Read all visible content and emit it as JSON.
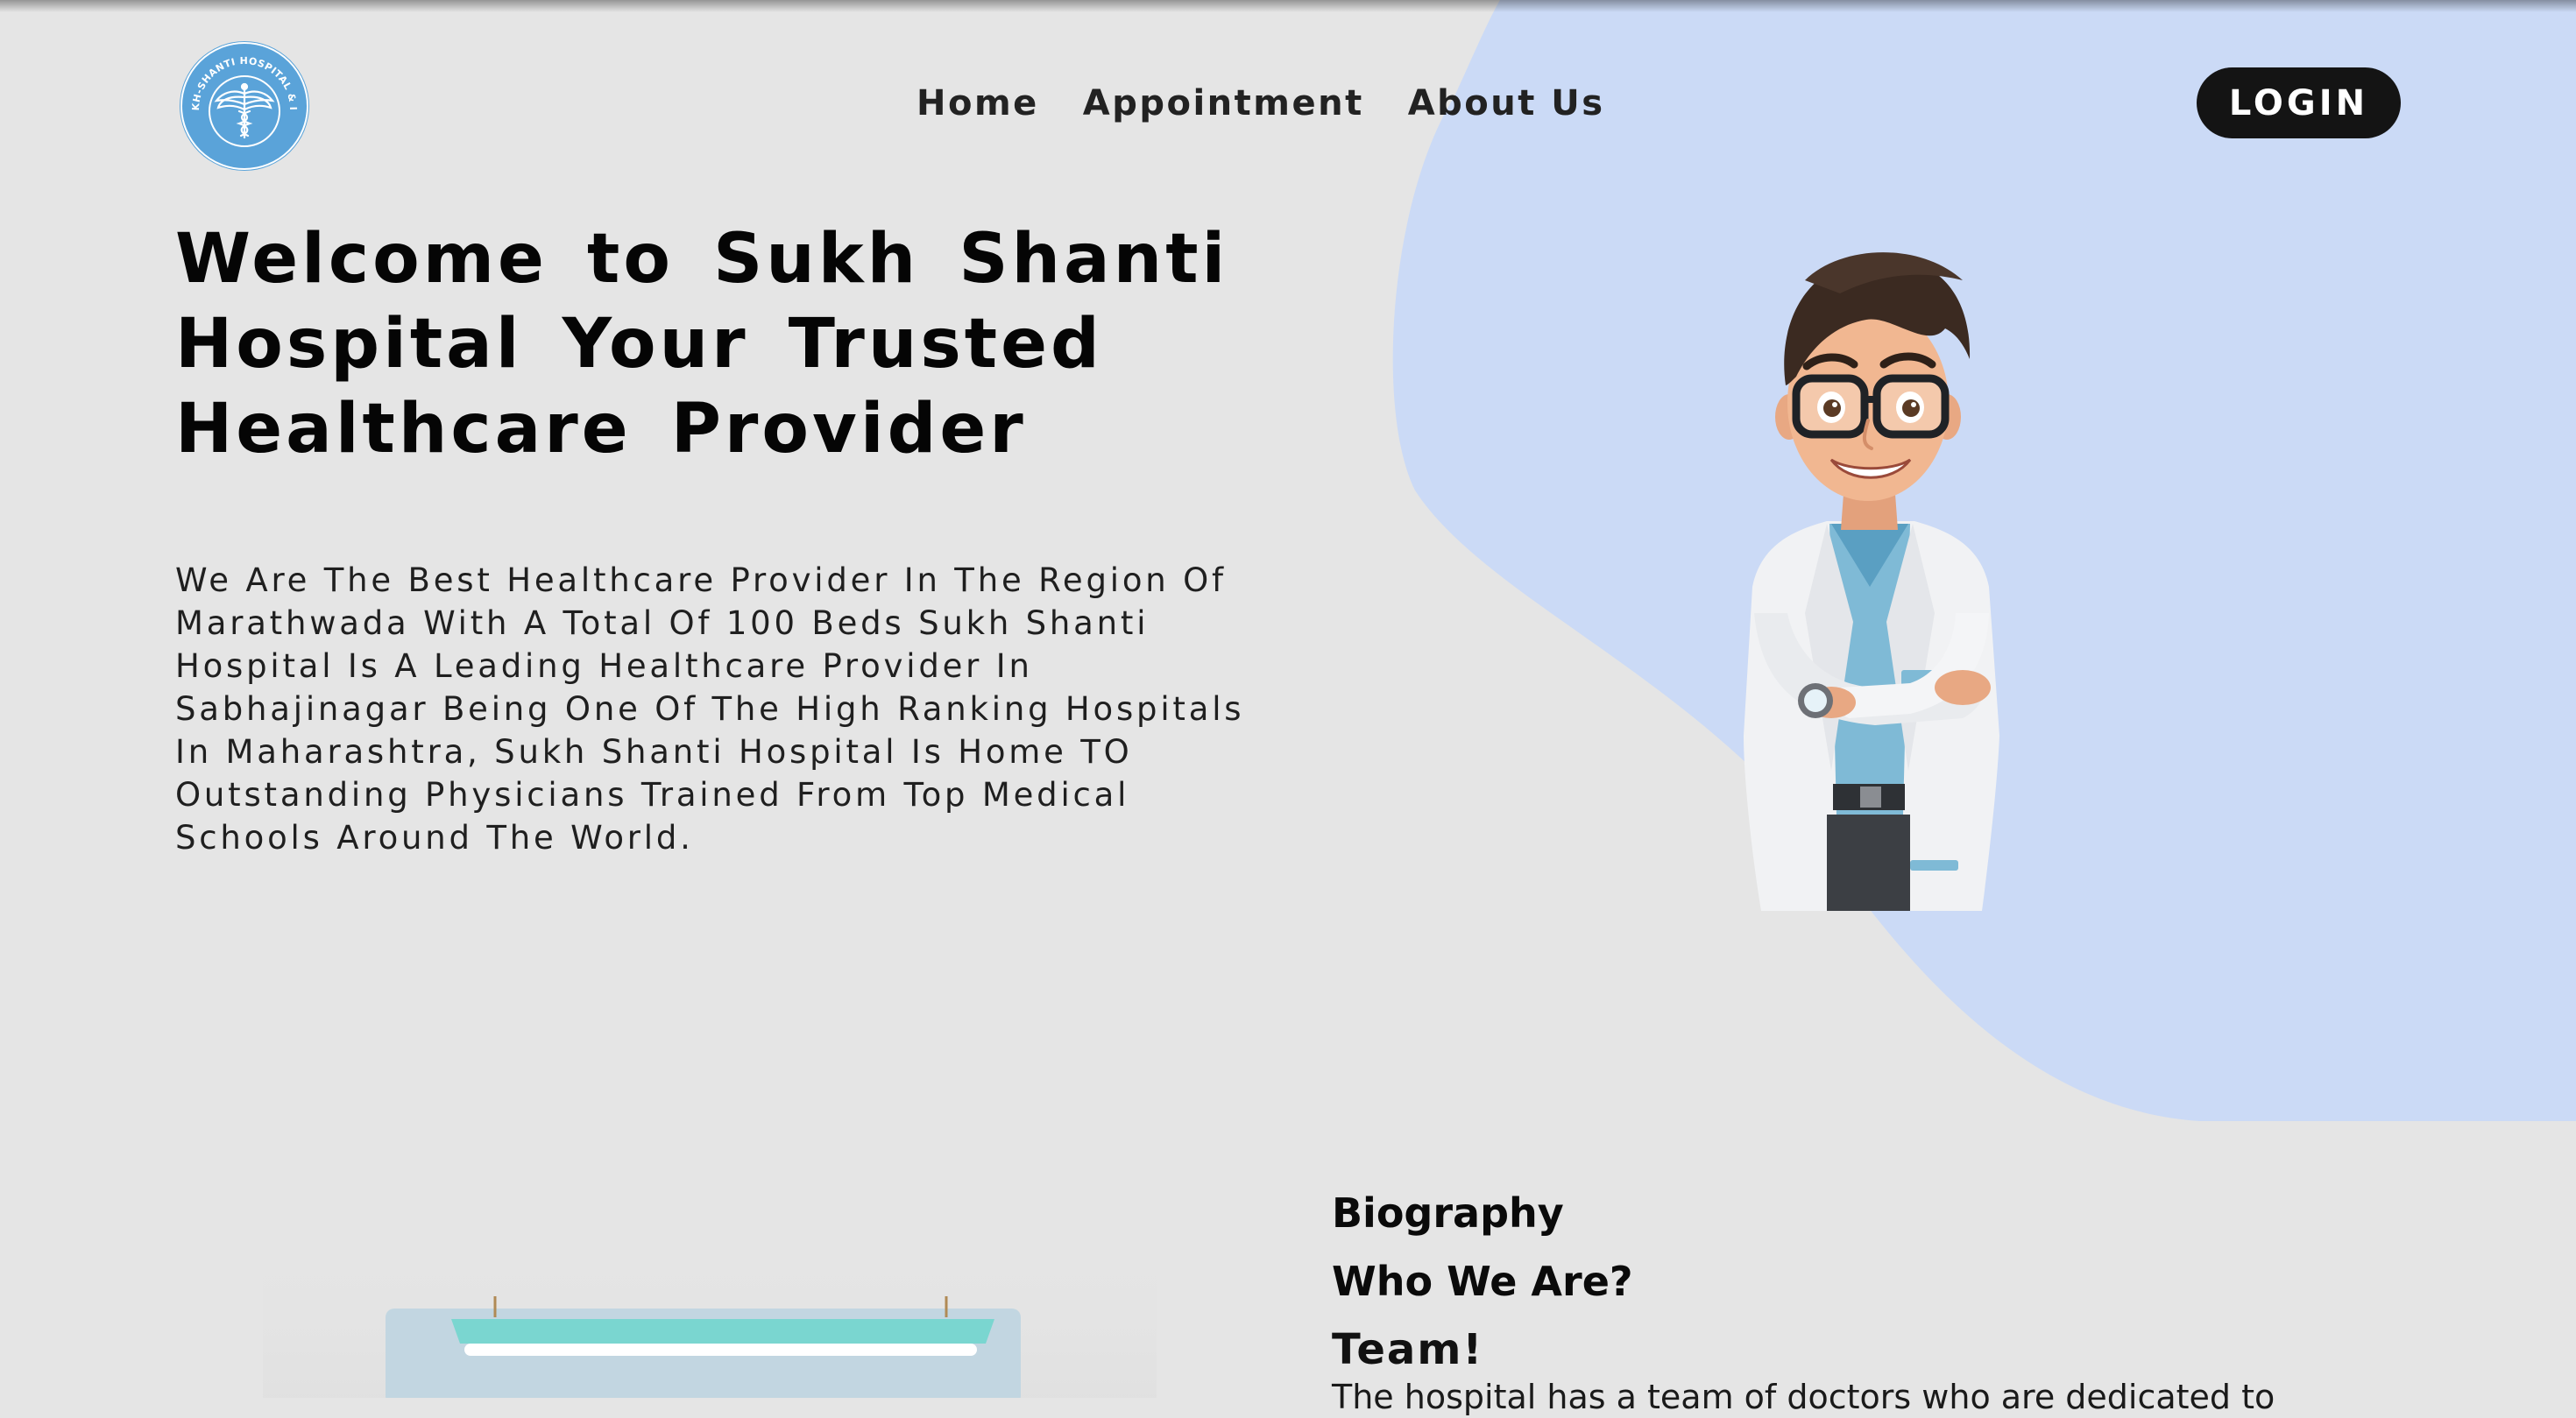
{
  "logo": {
    "ring_text": "SUKH-SHANTI HOSPITAL & ICU",
    "color": "#5aa3d9"
  },
  "nav": {
    "items": [
      "Home",
      "Appointment",
      "About Us"
    ]
  },
  "header": {
    "login_label": "LOGIN"
  },
  "hero": {
    "title": "Welcome to Sukh Shanti Hospital Your Trusted Healthcare Provider",
    "description": "We Are The Best Healthcare Provider In The Region Of Marathwada With A Total Of 100 Beds Sukh Shanti Hospital Is A Leading Healthcare Provider In Sabhajinagar Being One Of The High Ranking Hospitals In Maharashtra, Sukh Shanti Hospital Is Home TO Outstanding Physicians Trained From Top Medical Schools Around The World."
  },
  "about": {
    "label": "Biography",
    "heading": "Who We Are?",
    "subheading": "Team!",
    "text": "The hospital has a team of doctors who are dedicated to"
  },
  "colors": {
    "background": "#e5e5e5",
    "accent_blob": "#cbdaf6",
    "button": "#141414",
    "logo": "#5aa3d9"
  }
}
